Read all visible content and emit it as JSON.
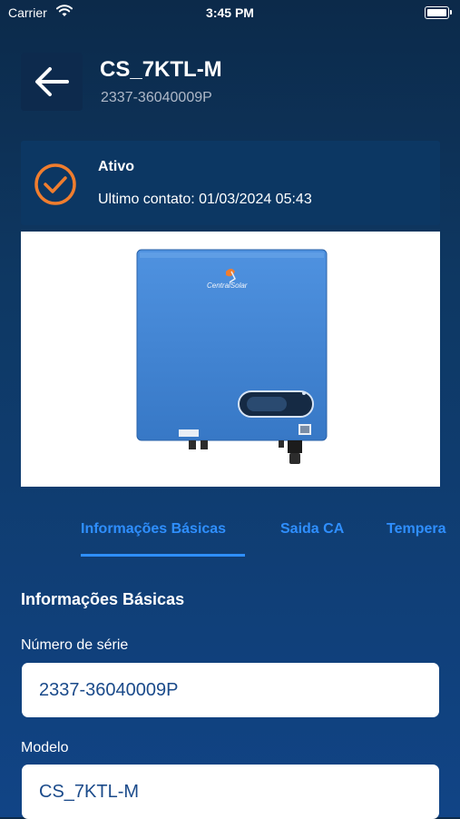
{
  "status_bar": {
    "carrier": "Carrier",
    "time": "3:45 PM"
  },
  "header": {
    "title": "CS_7KTL-M",
    "subtitle": "2337-36040009P"
  },
  "status_card": {
    "state": "Ativo",
    "last_contact": "Ultimo contato: 01/03/2024 05:43"
  },
  "product_image": {
    "brand_label": "CentralSolar"
  },
  "tabs": [
    {
      "label": "Informações Básicas",
      "active": true
    },
    {
      "label": "Saida CA",
      "active": false
    },
    {
      "label": "Tempera",
      "active": false
    }
  ],
  "section": {
    "title": "Informações Básicas",
    "fields": [
      {
        "label": "Número de série",
        "value": "2337-36040009P"
      },
      {
        "label": "Modelo",
        "value": "CS_7KTL-M"
      }
    ]
  },
  "colors": {
    "accent": "#2f8fff",
    "status_icon": "#f07d2e",
    "card": "#0c3763"
  }
}
